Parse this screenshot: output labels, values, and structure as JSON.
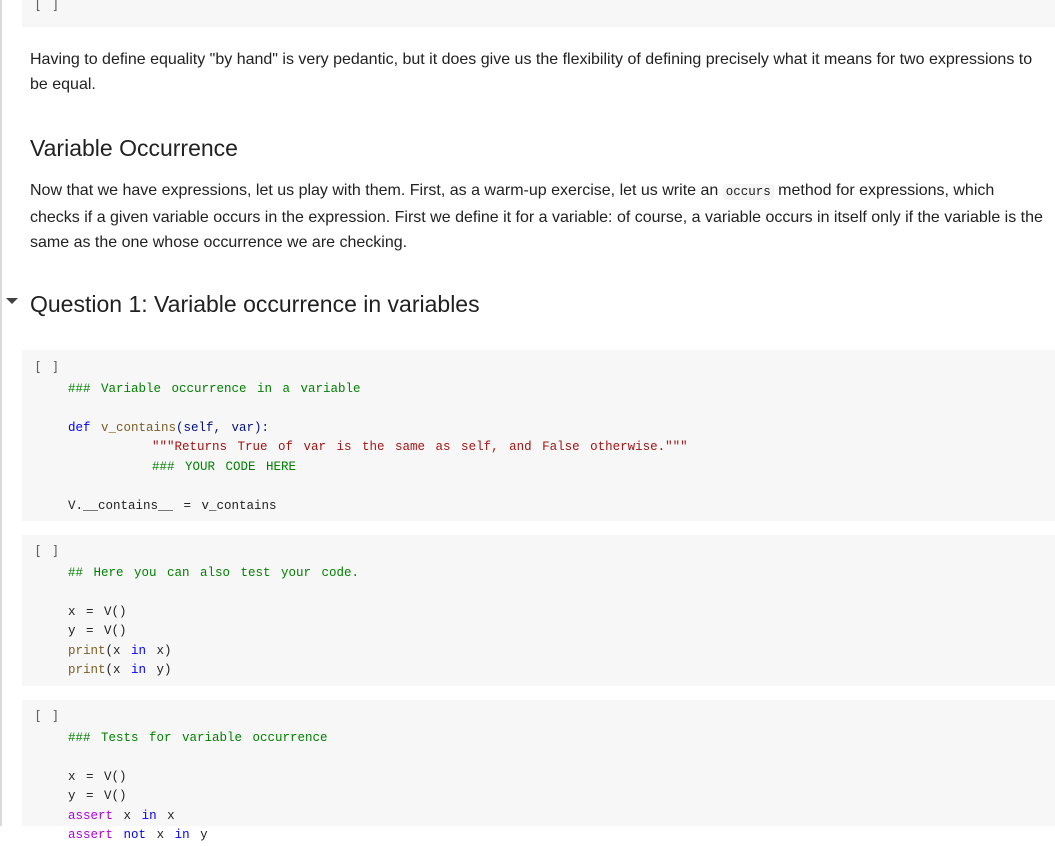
{
  "cells": {
    "top_cell": {
      "run_label": "[ ]"
    },
    "equality_text": "Having to define equality \"by hand\" is very pedantic, but it does give us the flexibility of defining precisely what it means for two expressions to be equal.",
    "section_heading": "Variable Occurrence",
    "occurrence_text": {
      "part1": "Now that we have expressions, let us play with them. First, as a warm-up exercise, let us write an ",
      "inline_code": "occurs",
      "part2": " method for expressions, which checks if a given variable occurs in the expression. First we define it for a variable: of course, a variable occurs in itself only if the variable is the same as the one whose occurrence we are checking."
    },
    "question_heading": "Question 1: Variable occurrence in variables",
    "code_cell_1": {
      "run_label": "[ ]",
      "comment": "### Variable occurrence in a variable",
      "def_kw": "def",
      "func_name": "v_contains",
      "params": "(self, var):",
      "docstring": "\"\"\"Returns True of var is the same as self, and False otherwise.\"\"\"",
      "todo_comment": "### YOUR CODE HERE",
      "assign_line": "V.__contains__ = v_contains"
    },
    "code_cell_2": {
      "run_label": "[ ]",
      "comment": "## Here you can also test your code.",
      "line1": "x = V()",
      "line2": "y = V()",
      "print_fn": "print",
      "line3_a": "(x ",
      "in_kw": "in",
      "line3_b": " x)",
      "line4_b": " y)"
    },
    "code_cell_3": {
      "run_label": "[ ]",
      "comment": "### Tests for variable occurrence",
      "line1": "x = V()",
      "line2": "y = V()",
      "assert_kw": "assert",
      "not_kw": "not",
      "in_kw": "in",
      "x": "x",
      "y": "y"
    }
  }
}
